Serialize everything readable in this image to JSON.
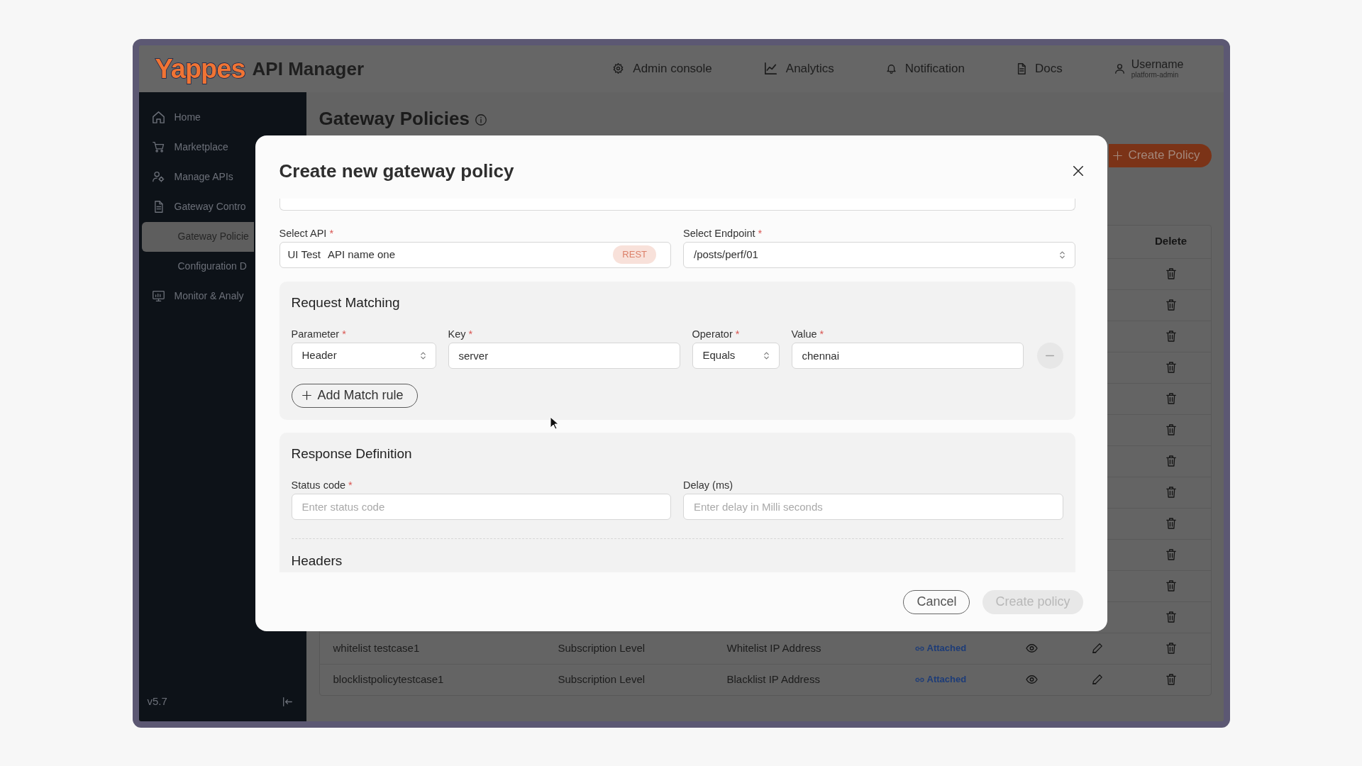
{
  "header": {
    "logo": "Yappes",
    "product": "API Manager",
    "nav": [
      {
        "label": "Admin console"
      },
      {
        "label": "Analytics"
      },
      {
        "label": "Notification"
      },
      {
        "label": "Docs"
      }
    ],
    "user": {
      "name": "Username",
      "role": "platform-admin"
    }
  },
  "sidebar": {
    "items": [
      {
        "label": "Home",
        "selected": false
      },
      {
        "label": "Marketplace",
        "selected": false
      },
      {
        "label": "Manage APIs",
        "selected": false
      },
      {
        "label": "Gateway Contro",
        "selected": false,
        "children": [
          {
            "label": "Gateway Policie",
            "selected": true
          },
          {
            "label": "Configuration D",
            "selected": false
          }
        ]
      },
      {
        "label": "Monitor & Analy",
        "selected": false
      }
    ],
    "version": "v5.7"
  },
  "page": {
    "title": "Gateway Policies",
    "create_button": "Create Policy"
  },
  "table": {
    "columns": [
      {
        "label": "Delete"
      }
    ],
    "rows": [
      {
        "kind": "covered"
      },
      {
        "kind": "covered"
      },
      {
        "kind": "covered"
      },
      {
        "kind": "covered"
      },
      {
        "kind": "covered"
      },
      {
        "kind": "covered"
      },
      {
        "kind": "covered"
      },
      {
        "kind": "covered"
      },
      {
        "kind": "covered"
      },
      {
        "kind": "covered"
      },
      {
        "kind": "covered"
      },
      {
        "kind": "covered"
      },
      {
        "kind": "full",
        "cells": [
          "whitelist testcase1",
          "Subscription Level",
          "Whitelist IP Address"
        ],
        "status": "Attached"
      },
      {
        "kind": "full",
        "cells": [
          "blocklistpolicytestcase1",
          "Subscription Level",
          "Blacklist IP Address"
        ],
        "status": "Attached"
      }
    ]
  },
  "modal": {
    "title": "Create new gateway policy",
    "fields": [
      {
        "kind": "api",
        "label": "Select API",
        "required_mark": "*",
        "prefix": "UI Test",
        "value": "API name one",
        "tag": "REST"
      },
      {
        "kind": "select",
        "label": "Select Endpoint",
        "required_mark": "*",
        "value": "/posts/perf/01"
      }
    ],
    "request_matching": {
      "title": "Request Matching",
      "rules": [
        {
          "fields": [
            {
              "kind": "select",
              "label": "Parameter",
              "required_mark": "*",
              "value": "Header"
            },
            {
              "kind": "input",
              "label": "Key",
              "required_mark": "*",
              "value": "server"
            },
            {
              "kind": "select",
              "label": "Operator",
              "required_mark": "*",
              "value": "Equals"
            },
            {
              "kind": "input",
              "label": "Value",
              "required_mark": "*",
              "value": "chennai"
            }
          ]
        }
      ],
      "add_button": "Add Match rule"
    },
    "response_definition": {
      "title": "Response Definition",
      "fields": [
        {
          "kind": "input",
          "label": "Status code",
          "required_mark": "*",
          "placeholder": "Enter status code"
        },
        {
          "kind": "input",
          "label": "Delay (ms)",
          "placeholder": "Enter delay in Milli seconds"
        }
      ],
      "next_section": "Headers"
    },
    "buttons": [
      {
        "label": "Cancel",
        "kind": "secondary",
        "disabled": false
      },
      {
        "label": "Create policy",
        "kind": "primary",
        "disabled": true
      }
    ]
  }
}
